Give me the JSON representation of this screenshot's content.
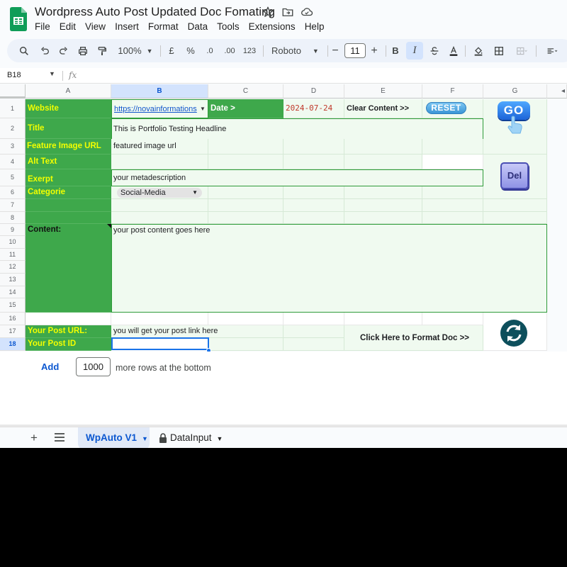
{
  "doc": {
    "title": "Wordpress Auto Post Updated Doc Fomating",
    "menu": [
      "File",
      "Edit",
      "View",
      "Insert",
      "Format",
      "Data",
      "Tools",
      "Extensions",
      "Help"
    ]
  },
  "toolbar": {
    "zoom": "100%",
    "currency": "£",
    "percent": "%",
    "dec_decrease": ".0",
    "dec_increase": ".00",
    "number_format": "123",
    "font": "Roboto",
    "font_size": "11",
    "bold": "B",
    "italic": "I"
  },
  "formula_bar": {
    "cell_ref": "B18",
    "fx": "fx"
  },
  "columns": [
    "A",
    "B",
    "C",
    "D",
    "E",
    "F",
    "G"
  ],
  "rows": [
    "1",
    "2",
    "3",
    "4",
    "5",
    "6",
    "7",
    "8",
    "9",
    "10",
    "11",
    "12",
    "13",
    "14",
    "15",
    "16",
    "17",
    "18"
  ],
  "sheet": {
    "website_label": "Website",
    "website_value": "https://novainformations",
    "date_label": "Date >",
    "date_value": "2024-07-24",
    "clear_label": "Clear Content >>",
    "reset_button": "RESET",
    "go_button": "GO",
    "title_label": "Title",
    "title_value": "This is Portfolio Testing Headline",
    "feature_label": "Feature Image URL",
    "feature_value": "featured image url",
    "alt_label": "Alt Text",
    "exerpt_label": "Exerpt",
    "exerpt_value": "your metadescription",
    "del_button": "Del",
    "categorie_label": "Categorie",
    "categorie_value": "Social-Media",
    "content_label": "Content:",
    "content_value": "your post content goes here",
    "post_url_label": "Your Post URL:",
    "post_url_value": "you will get your post link here",
    "post_id_label": "Your Post ID",
    "format_label": "Click Here to Format Doc >>"
  },
  "add_rows": {
    "button": "Add",
    "count": "1000",
    "suffix": "more rows at the bottom"
  },
  "tabs": [
    {
      "label": "WpAuto V1",
      "active": true
    },
    {
      "label": "DataInput",
      "locked": true
    }
  ],
  "colors": {
    "green": "#3ea84b",
    "label_yellow": "#f2ff00",
    "accent_blue": "#1a73e8",
    "date_red": "#c0392b"
  }
}
